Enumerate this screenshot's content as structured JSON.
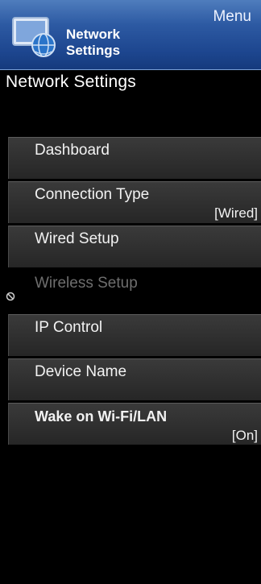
{
  "header": {
    "menu_label": "Menu",
    "title": "Network Settings",
    "icon": "network-settings-icon"
  },
  "page_title": "Network Settings",
  "menu_items": [
    {
      "label": "Dashboard",
      "value": "",
      "disabled": false
    },
    {
      "label": "Connection Type",
      "value": "[Wired]",
      "disabled": false
    },
    {
      "label": "Wired Setup",
      "value": "",
      "disabled": false
    },
    {
      "label": "Wireless Setup",
      "value": "",
      "disabled": true,
      "icon": "disabled-icon"
    },
    {
      "label": "IP Control",
      "value": "",
      "disabled": false
    },
    {
      "label": "Device Name",
      "value": "",
      "disabled": false
    },
    {
      "label": "Wake on Wi-Fi/LAN",
      "value": "[On]",
      "disabled": false,
      "selected": true
    }
  ],
  "colors": {
    "header_bg": "#2d5aa3",
    "item_bg": "#333333",
    "disabled_text": "#6e6e6e",
    "background": "#000000"
  }
}
